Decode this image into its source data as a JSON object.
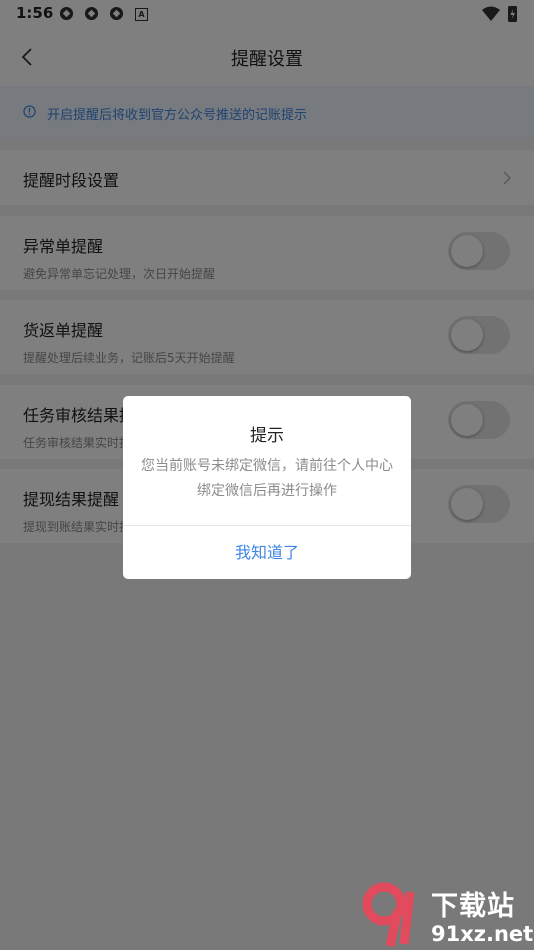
{
  "status_bar": {
    "time": "1:56",
    "notification_icons": [
      "app-icon",
      "app-icon",
      "app-icon"
    ],
    "a_badge": "A"
  },
  "header": {
    "title": "提醒设置",
    "back_icon": "chevron-left-icon"
  },
  "notice": {
    "icon": "info-icon",
    "text": "开启提醒后将收到官方公众号推送的记账提示",
    "color": "#3f86e3"
  },
  "period_row": {
    "label": "提醒时段设置"
  },
  "settings": [
    {
      "title": "异常单提醒",
      "description": "避免异常单忘记处理，次日开始提醒",
      "enabled": false
    },
    {
      "title": "货返单提醒",
      "description": "提醒处理后续业务，记账后5天开始提醒",
      "enabled": false
    },
    {
      "title": "任务审核结果提醒",
      "description": "任务审核结果实时提醒",
      "enabled": false
    },
    {
      "title": "提现结果提醒",
      "description": "提现到账结果实时提醒",
      "enabled": false
    }
  ],
  "dialog": {
    "title": "提示",
    "message": "您当前账号未绑定微信，请前往个人中心绑定微信后再进行操作",
    "confirm_label": "我知道了"
  },
  "watermark": {
    "line1": "下载站",
    "line2": "91xz.net"
  }
}
